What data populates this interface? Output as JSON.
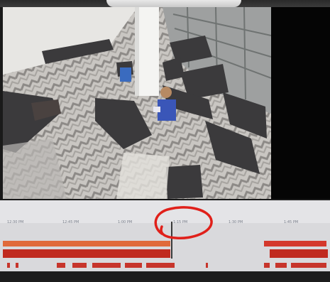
{
  "camera": {
    "timestamp": "",
    "scene": "lobby-overhead-camera"
  },
  "timeline": {
    "ticks": [
      "12:30 PM",
      "12:45 PM",
      "1:00 PM",
      "1:15 PM",
      "1:30 PM",
      "1:45 PM"
    ],
    "playhead_label": "1:07 PM",
    "annotation_color": "#e0201a",
    "track_color": "#d4382c"
  },
  "footer": {
    "text": ""
  }
}
